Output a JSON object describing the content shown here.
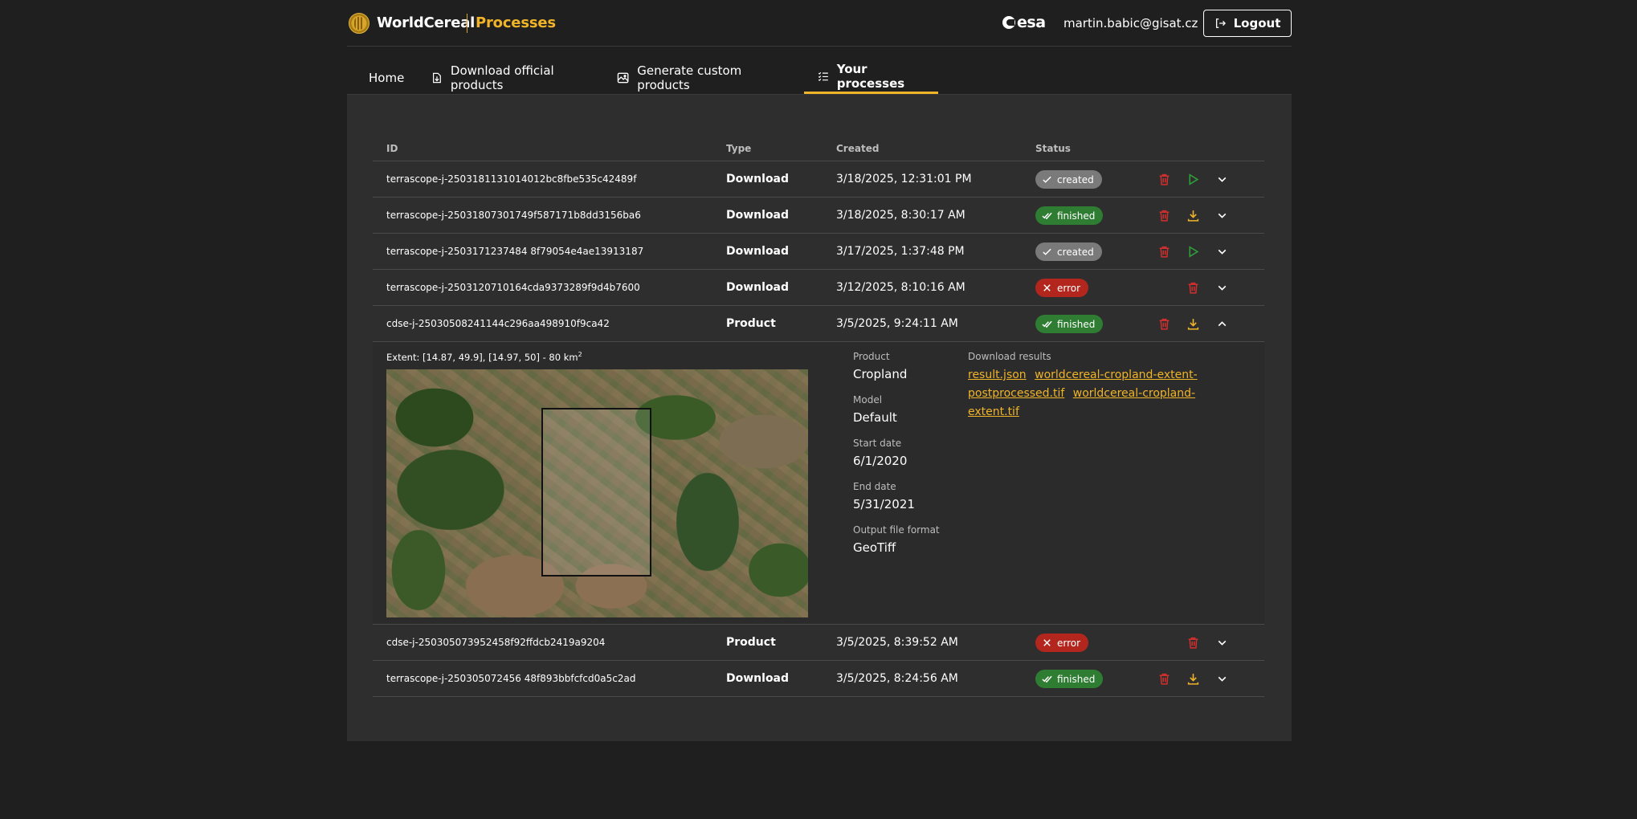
{
  "header": {
    "brand": "WorldCereal",
    "subtitle": "Processes",
    "partner": "esa",
    "user_email": "martin.babic@gisat.cz",
    "logout_label": "Logout"
  },
  "tabs": [
    {
      "label": "Home",
      "icon": "home-icon"
    },
    {
      "label": "Download official products",
      "icon": "file-download-icon"
    },
    {
      "label": "Generate custom products",
      "icon": "image-edit-icon"
    },
    {
      "label": "Your processes",
      "icon": "checklist-icon",
      "active": true
    }
  ],
  "table": {
    "columns": {
      "id": "ID",
      "type": "Type",
      "created": "Created",
      "status": "Status"
    },
    "rows": [
      {
        "id": "terrascope-j-2503181131014012bc8fbe535c42489f",
        "type": "Download",
        "created": "3/18/2025, 12:31:01 PM",
        "status": "created"
      },
      {
        "id": "terrascope-j-25031807301749f587171b8dd3156ba6",
        "type": "Download",
        "created": "3/18/2025, 8:30:17 AM",
        "status": "finished"
      },
      {
        "id": "terrascope-j-2503171237484 8f79054e4ae13913187",
        "type": "Download",
        "created": "3/17/2025, 1:37:48 PM",
        "status": "created"
      },
      {
        "id": "terrascope-j-2503120710164cda9373289f9d4b7600",
        "type": "Download",
        "created": "3/12/2025, 8:10:16 AM",
        "status": "error"
      },
      {
        "id": "cdse-j-25030508241144c296aa498910f9ca42",
        "type": "Product",
        "created": "3/5/2025, 9:24:11 AM",
        "status": "finished"
      },
      {
        "id": "cdse-j-250305073952458f92ffdcb2419a9204",
        "type": "Product",
        "created": "3/5/2025, 8:39:52 AM",
        "status": "error"
      },
      {
        "id": "terrascope-j-250305072456 48f893bbfcfcd0a5c2ad",
        "type": "Download",
        "created": "3/5/2025, 8:24:56 AM",
        "status": "finished"
      }
    ]
  },
  "detail": {
    "extent_text": "Extent: [14.87, 49.9], [14.97, 50] - 80 km",
    "extent_sup": "2",
    "product_label": "Product",
    "product_value": "Cropland",
    "model_label": "Model",
    "model_value": "Default",
    "start_label": "Start date",
    "start_value": "6/1/2020",
    "end_label": "End date",
    "end_value": "5/31/2021",
    "format_label": "Output file format",
    "format_value": "GeoTiff",
    "download_label": "Download results",
    "links": [
      "result.json",
      "worldcereal-cropland-extent-postprocessed.tif",
      "worldcereal-cropland-extent.tif"
    ]
  },
  "colors": {
    "accent": "#f0b429",
    "finished": "#2e7d32",
    "error": "#b3261e",
    "created": "#7a7a7a",
    "delete_icon": "#d32f2f",
    "play_icon": "#2e9e3a"
  }
}
